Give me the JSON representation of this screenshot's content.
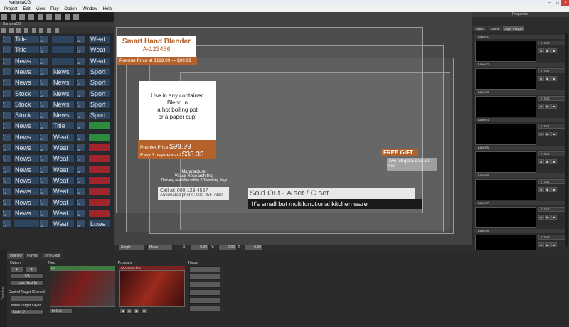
{
  "app": {
    "title": "KarismaCG",
    "menu": [
      "Project",
      "Edit",
      "View",
      "Play",
      "Option",
      "Window",
      "Help"
    ]
  },
  "left_panel": {
    "tab": "KarismaCG",
    "rows": [
      {
        "n1": "0",
        "n1b": "1",
        "c1": "Title",
        "n2": "2",
        "n2b": "18",
        "c2": "",
        "n3": "3",
        "n3b": "36",
        "c3": "Weat",
        "s3": ""
      },
      {
        "n1": "0",
        "n1b": "1",
        "c1": "Title",
        "n2": "3",
        "n2b": "19",
        "c2": "",
        "n3": "3",
        "n3b": "37",
        "c3": "Weat",
        "s3": ""
      },
      {
        "n1": "0",
        "n1b": "2",
        "c1": "News",
        "n2": "4",
        "n2b": "20",
        "c2": "",
        "n3": "3",
        "n3b": "38",
        "c3": "Weat",
        "s3": ""
      },
      {
        "n1": "0",
        "n1b": "3",
        "c1": "News",
        "n2": "4",
        "n2b": "21",
        "c2": "News",
        "n3": "4",
        "n3b": "39",
        "c3": "Sport",
        "s3": ""
      },
      {
        "n1": "0",
        "n1b": "4",
        "c1": "News",
        "n2": "4",
        "n2b": "22",
        "c2": "News",
        "n3": "4",
        "n3b": "40",
        "c3": "Sport",
        "s3": ""
      },
      {
        "n1": "0",
        "n1b": "5",
        "c1": "Stock",
        "n2": "4",
        "n2b": "23",
        "c2": "News",
        "n3": "4",
        "n3b": "41",
        "c3": "Sport",
        "s3": ""
      },
      {
        "n1": "0",
        "n1b": "6",
        "c1": "Stock",
        "n2": "4",
        "n2b": "24",
        "c2": "News",
        "n3": "4",
        "n3b": "42",
        "c3": "Sport",
        "s3": ""
      },
      {
        "n1": "0",
        "n1b": "7",
        "c1": "Stock",
        "n2": "4",
        "n2b": "25",
        "c2": "News",
        "n3": "4",
        "n3b": "43",
        "c3": "Sport",
        "s3": ""
      },
      {
        "n1": "0",
        "n1b": "8",
        "c1": "News",
        "n2": "4",
        "n2b": "26",
        "c2": "Title",
        "n3": "4",
        "n3b": "44",
        "c3": "",
        "s3": "green"
      },
      {
        "n1": "0",
        "n1b": "9",
        "c1": "News",
        "n2": "4",
        "n2b": "27",
        "c2": "Weat",
        "n3": "4",
        "n3b": "45",
        "c3": "",
        "s3": "green"
      },
      {
        "n1": "0",
        "n1b": "10",
        "c1": "News",
        "n2": "4",
        "n2b": "28",
        "c2": "Weat",
        "n3": "4",
        "n3b": "46",
        "c3": "",
        "s3": "red"
      },
      {
        "n1": "0",
        "n1b": "11",
        "c1": "News",
        "n2": "4",
        "n2b": "29",
        "c2": "Weat",
        "n3": "4",
        "n3b": "47",
        "c3": "",
        "s3": "red"
      },
      {
        "n1": "0",
        "n1b": "12",
        "c1": "News",
        "n2": "4",
        "n2b": "30",
        "c2": "Weat",
        "n3": "4",
        "n3b": "48",
        "c3": "",
        "s3": "red"
      },
      {
        "n1": "0",
        "n1b": "13",
        "c1": "News",
        "n2": "4",
        "n2b": "31",
        "c2": "Weat",
        "n3": "4",
        "n3b": "49",
        "c3": "",
        "s3": "red"
      },
      {
        "n1": "0",
        "n1b": "14",
        "c1": "News",
        "n2": "4",
        "n2b": "32",
        "c2": "Weat",
        "n3": "4",
        "n3b": "50",
        "c3": "",
        "s3": "red"
      },
      {
        "n1": "0",
        "n1b": "15",
        "c1": "News",
        "n2": "4",
        "n2b": "33",
        "c2": "Weat",
        "n3": "4",
        "n3b": "51",
        "c3": "",
        "s3": "red"
      },
      {
        "n1": "0",
        "n1b": "16",
        "c1": "News",
        "n2": "4",
        "n2b": "34",
        "c2": "Weat",
        "n3": "4",
        "n3b": "52",
        "c3": "",
        "s3": "red"
      },
      {
        "n1": "0",
        "n1b": "17",
        "c1": "",
        "n2": "4",
        "n2b": "35",
        "c2": "Weat",
        "n3": "4",
        "n3b": "53",
        "c3": "Lowe",
        "s3": ""
      }
    ]
  },
  "canvas": {
    "product_title": "Smart Hand Blender",
    "product_code": "A-123456",
    "premier_price": "Premier Price at $119.99 -> $99.99",
    "blurb": "Use in any container.\nBlend in\na hot boiling pot\nor a paper cup!",
    "price_label": "Premier Price",
    "price_value": "$99.99",
    "easy_label": "Easy 3 payments of",
    "easy_value": "$33.33",
    "manufacturer_label": "Manufacturer",
    "manufacturer_name": "Visual Research Inc.",
    "delivery": "Delivery availalbe within 2-3 working days",
    "call_at": "Call at: 000-123-4567",
    "automated_phone": "Automated phone: 000-456-7890",
    "free_gift": "FREE GIFT",
    "free_gift_detail": "Two full glass sets are free",
    "sold_out": "Sold Out - A set / C set",
    "tagline": "It's small but multifunctional kitchen ware",
    "status_mode": "Single",
    "status_move": "Move",
    "x_label": "X:",
    "x_value": "0.00",
    "y_label": "Y:",
    "y_value": "0.00",
    "z_label": "Z:",
    "z_value": "0.00"
  },
  "right_panel": {
    "title": "Properties",
    "tabs": [
      "Object",
      "Scene",
      "Layer Playout"
    ],
    "layers": [
      "Layer 1",
      "Layer 2",
      "Layer 3",
      "Layer 4",
      "Layer 5",
      "Layer 6",
      "Layer 7",
      "Layer 8"
    ],
    "layer_mode": "In Out"
  },
  "bottom": {
    "tabs": [
      "Timeline",
      "Playlist",
      "TimeCode"
    ],
    "option_label": "Option",
    "ok_label": "OK",
    "last_next_label": "Last Next In",
    "control_channel_label": "Control Target Channel",
    "control_layer_label": "Control Target Layer",
    "layer_value": "Layer 0",
    "next_label": "Next",
    "next_file": "00",
    "program_label": "Program",
    "program_file": "KCG0003.kcs",
    "trigger_label": "Trigger",
    "inout": "In Out",
    "side_label": "Timeline"
  },
  "colors": {
    "accent_orange": "#b4622a",
    "panel_bg": "#2b2b2b",
    "cell_blue": "#2e4560"
  }
}
